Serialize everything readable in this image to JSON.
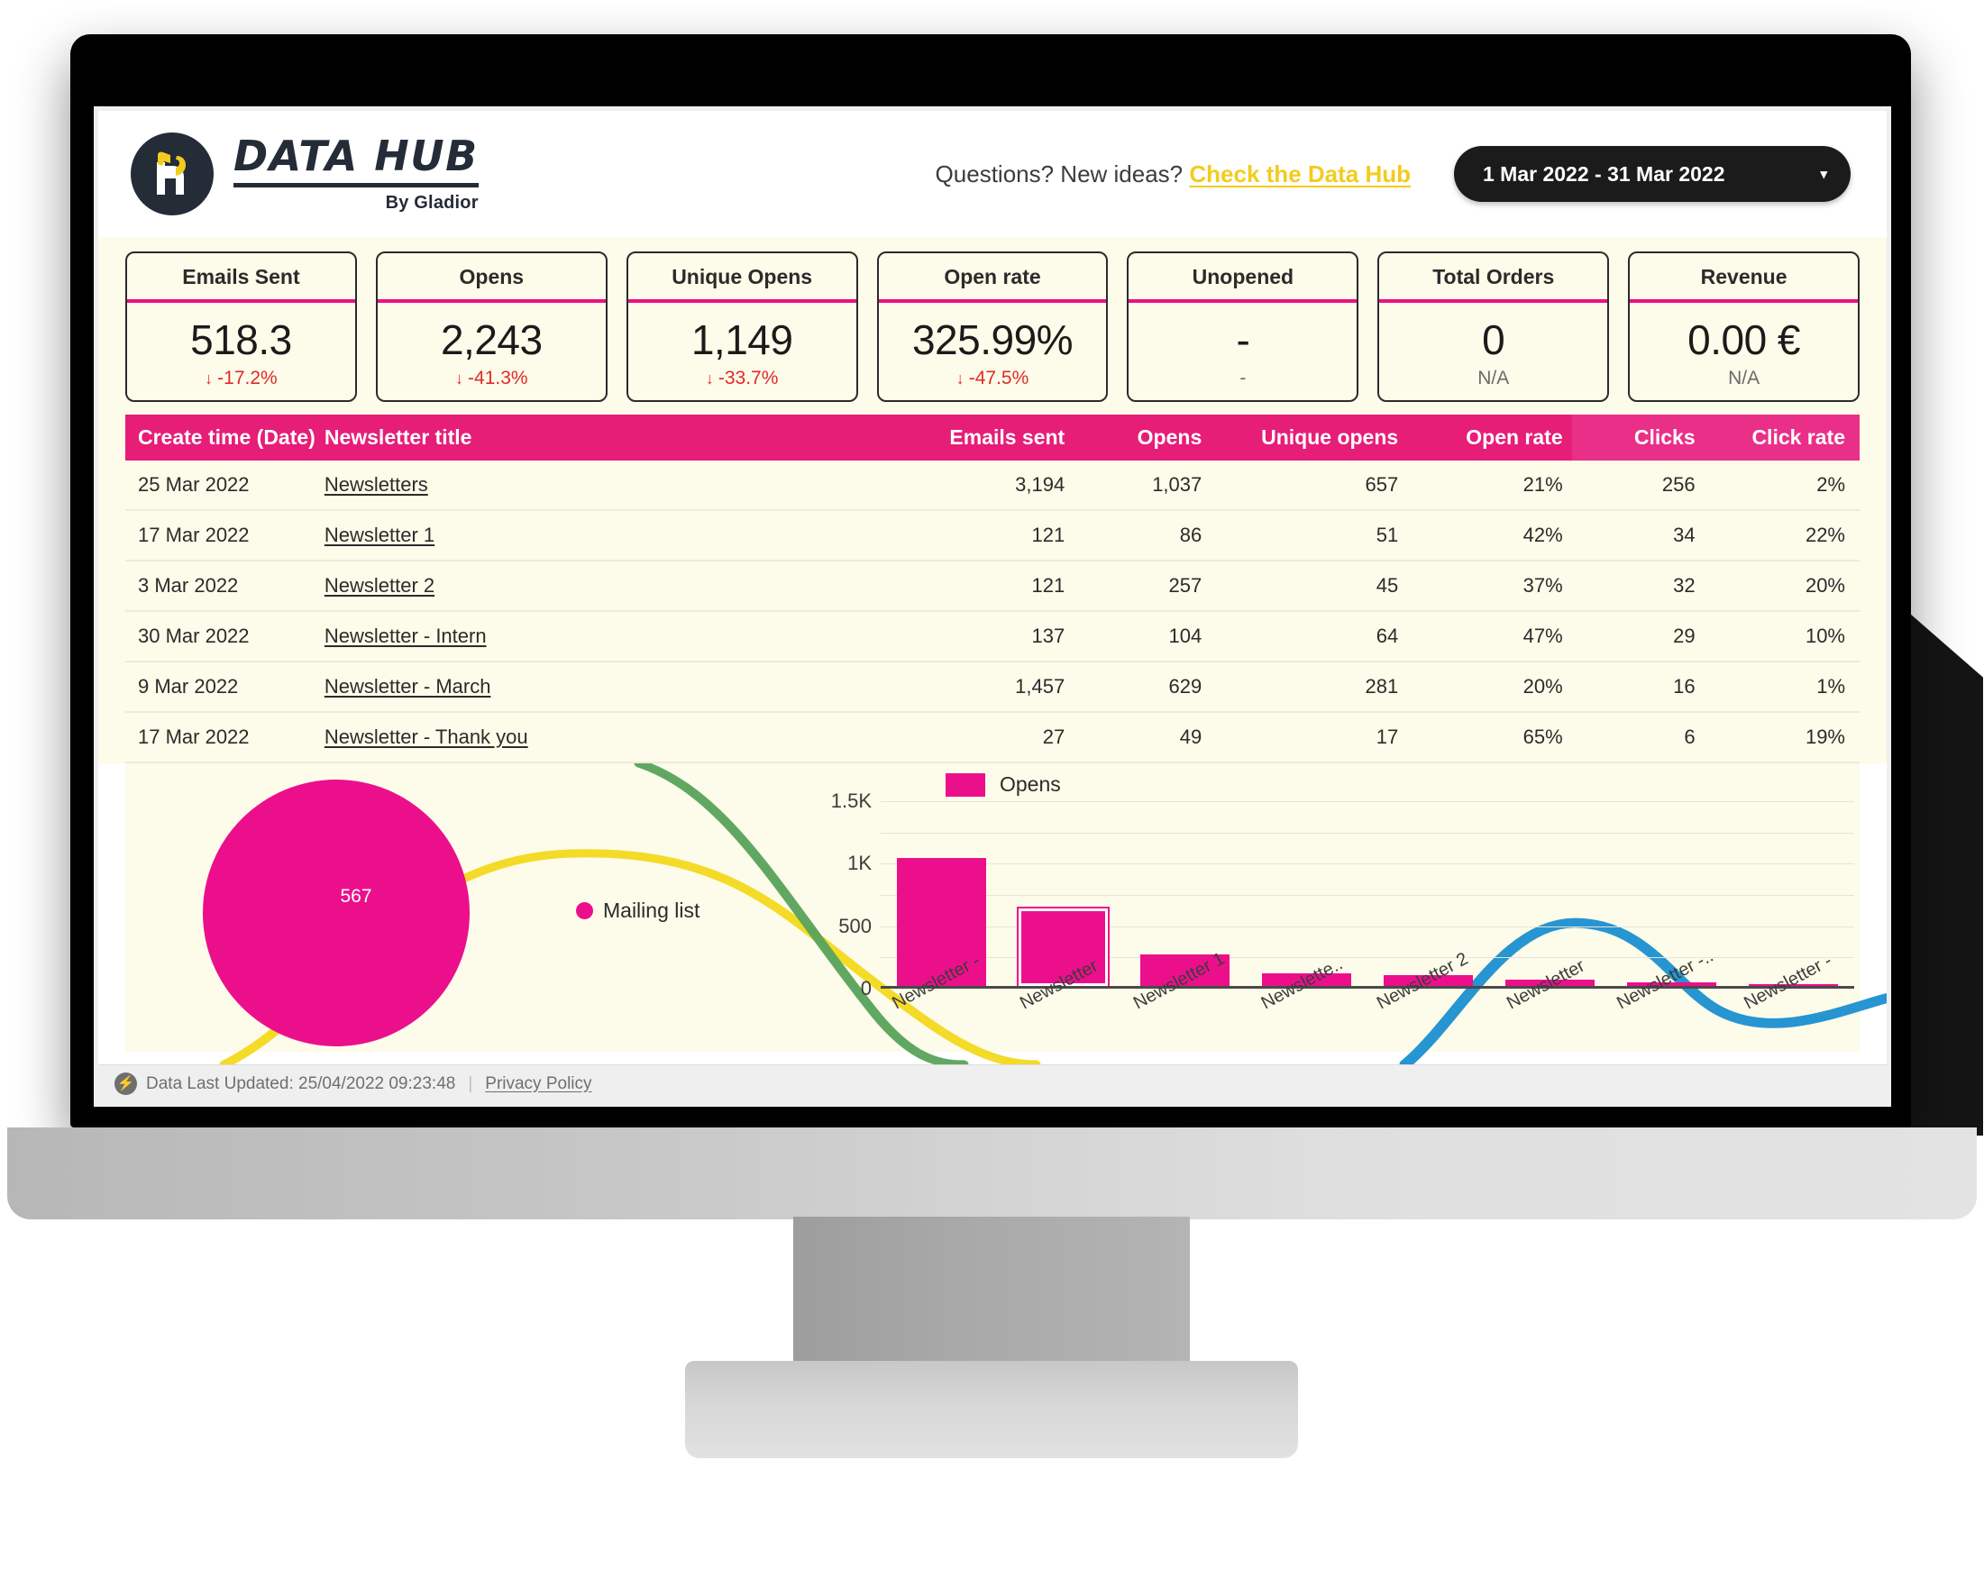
{
  "brand": {
    "logo_title": "DATA HUB",
    "logo_sub": "By Gladior",
    "accent_pink": "#ec0f8c",
    "accent_yellow": "#f2cc1e",
    "dark": "#242c38"
  },
  "header": {
    "questions_text": "Questions? New ideas?",
    "questions_link": "Check the Data Hub",
    "date_range": "1 Mar 2022 - 31 Mar 2022",
    "caret": "▾"
  },
  "kpis": [
    {
      "label": "Emails Sent",
      "value": "518.3",
      "delta": "-17.2%",
      "arrow": "↓",
      "neutral": false
    },
    {
      "label": "Opens",
      "value": "2,243",
      "delta": "-41.3%",
      "arrow": "↓",
      "neutral": false
    },
    {
      "label": "Unique Opens",
      "value": "1,149",
      "delta": "-33.7%",
      "arrow": "↓",
      "neutral": false
    },
    {
      "label": "Open rate",
      "value": "325.99%",
      "delta": "-47.5%",
      "arrow": "↓",
      "neutral": false
    },
    {
      "label": "Unopened",
      "value": "-",
      "delta": "-",
      "arrow": "",
      "neutral": true
    },
    {
      "label": "Total Orders",
      "value": "0",
      "delta": "N/A",
      "arrow": "",
      "neutral": true
    },
    {
      "label": "Revenue",
      "value": "0.00 €",
      "delta": "N/A",
      "arrow": "",
      "neutral": true
    }
  ],
  "table": {
    "columns": [
      "Create time (Date)",
      "Newsletter title",
      "Emails sent",
      "Opens",
      "Unique opens",
      "Open rate",
      "Clicks",
      "Click rate"
    ],
    "rows": [
      {
        "date": "25 Mar 2022",
        "title": "Newsletters",
        "emails_sent": "3,194",
        "opens": "1,037",
        "unique_opens": "657",
        "open_rate": "21%",
        "clicks": "256",
        "click_rate": "2%"
      },
      {
        "date": "17 Mar 2022",
        "title": "Newsletter 1",
        "emails_sent": "121",
        "opens": "86",
        "unique_opens": "51",
        "open_rate": "42%",
        "clicks": "34",
        "click_rate": "22%"
      },
      {
        "date": "3 Mar 2022",
        "title": "Newsletter 2",
        "emails_sent": "121",
        "opens": "257",
        "unique_opens": "45",
        "open_rate": "37%",
        "clicks": "32",
        "click_rate": "20%"
      },
      {
        "date": "30 Mar 2022",
        "title": "Newsletter - Intern",
        "emails_sent": "137",
        "opens": "104",
        "unique_opens": "64",
        "open_rate": "47%",
        "clicks": "29",
        "click_rate": "10%"
      },
      {
        "date": "9 Mar 2022",
        "title": "Newsletter - March",
        "emails_sent": "1,457",
        "opens": "629",
        "unique_opens": "281",
        "open_rate": "20%",
        "clicks": "16",
        "click_rate": "1%"
      },
      {
        "date": "17 Mar 2022",
        "title": "Newsletter - Thank you",
        "emails_sent": "27",
        "opens": "49",
        "unique_opens": "17",
        "open_rate": "65%",
        "clicks": "6",
        "click_rate": "19%"
      }
    ]
  },
  "chart_data": [
    {
      "type": "pie",
      "title": "",
      "legend_position": "right",
      "labels": [
        "Mailing list"
      ],
      "values": [
        567
      ],
      "data_labels": [
        "567"
      ],
      "colors": [
        "#ec0f8c"
      ]
    },
    {
      "type": "bar",
      "title": "",
      "xlabel": "",
      "ylabel": "",
      "ylim": [
        0,
        1500
      ],
      "ytick_labels": [
        "0",
        "500",
        "1K",
        "1.5K"
      ],
      "yticks": [
        0,
        500,
        1000,
        1500
      ],
      "grid": true,
      "legend": [
        "Opens"
      ],
      "legend_position": "top-left",
      "color": "#ec0f8c",
      "selected_index": 1,
      "categories": [
        "Newsletter -",
        "Newsletter",
        "Newsletter 1",
        "Newslette..",
        "Newsletter 2",
        "Newsletter",
        "Newsletter -..",
        "Newsletter -"
      ],
      "values": [
        1037,
        629,
        257,
        104,
        86,
        49,
        27,
        10
      ]
    }
  ],
  "footer": {
    "bolt": "⚡",
    "updated": "Data Last Updated: 25/04/2022 09:23:48",
    "separator": "|",
    "privacy": "Privacy Policy"
  }
}
